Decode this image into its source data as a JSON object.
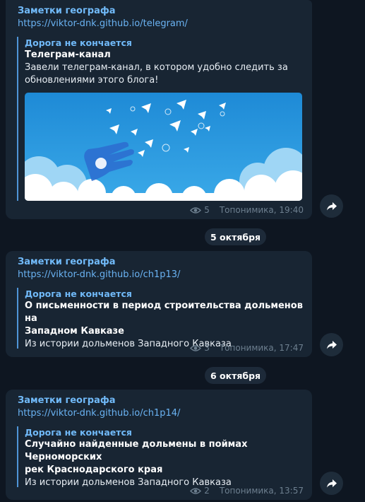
{
  "messages": [
    {
      "channel": "Заметки географа",
      "link": "https://viktor-dnk.github.io/telegram/",
      "site_name": "Дорога не кончается",
      "preview_title": "Телеграм-канал",
      "preview_desc_lines": [
        "Завели телеграм-канал, в котором удобно следить за",
        "обновлениями этого блога!"
      ],
      "views": "5",
      "author_time": "Топонимика, 19:40"
    },
    {
      "channel": "Заметки географа",
      "link": "https://viktor-dnk.github.io/ch1p13/",
      "site_name": "Дорога не кончается",
      "preview_title_lines": [
        "О письменности в период строительства дольменов на",
        "Западном Кавказе"
      ],
      "preview_desc": "Из истории дольменов Западного Кавказа",
      "views": "3",
      "author_time": "Топонимика, 17:47"
    },
    {
      "channel": "Заметки географа",
      "link": "https://viktor-dnk.github.io/ch1p14/",
      "site_name": "Дорога не кончается",
      "preview_title_lines": [
        "Случайно найденные дольмены в поймах Черноморских",
        "рек Краснодарского края"
      ],
      "preview_desc": "Из истории дольменов Западного Кавказа",
      "views": "2",
      "author_time": "Топонимика, 13:57"
    }
  ],
  "date_separators": [
    "5 октября",
    "6 октября"
  ],
  "colors": {
    "background": "#0e1621",
    "bubble": "#182533",
    "accent": "#71baf9",
    "link": "#6ab3f3",
    "meta": "#6d7f8f"
  }
}
